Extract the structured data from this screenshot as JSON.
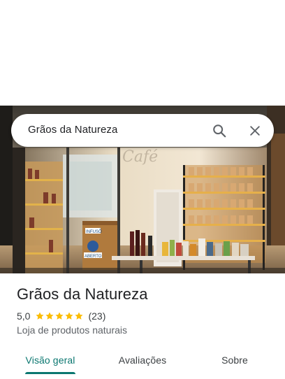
{
  "search": {
    "query": "Grãos da Natureza"
  },
  "photo": {
    "sign_text": "Café",
    "door_sign_top": "INFUSÕ",
    "door_sign_bottom": "ABERTO"
  },
  "place": {
    "name": "Grãos da Natureza",
    "rating": "5,0",
    "stars": 5,
    "review_count": "(23)",
    "category": "Loja de produtos naturais"
  },
  "tabs": [
    {
      "label": "Visão geral",
      "active": true
    },
    {
      "label": "Avaliações",
      "active": false
    },
    {
      "label": "Sobre",
      "active": false
    }
  ],
  "colors": {
    "accent": "#0b7770",
    "star": "#fbbc04"
  },
  "icons": {
    "search": "search-icon",
    "close": "close-icon",
    "star": "star-icon"
  }
}
